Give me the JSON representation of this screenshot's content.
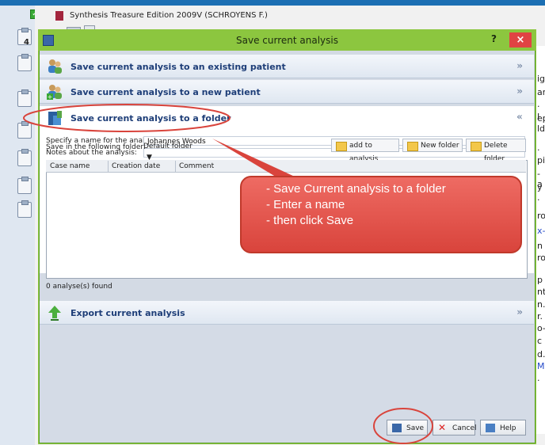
{
  "background_app": {
    "title": "Synthesis Treasure Edition 2009V (SCHROYENS F.)",
    "sidebar_number": "4",
    "right_fragments": [
      "ig",
      "ar",
      "· I",
      "ep",
      "ld",
      ".",
      "pis",
      "-a",
      "y",
      "·",
      "ro",
      "x-",
      " n",
      "ro",
      "p",
      "nt",
      "n.",
      "r.",
      "o-",
      " c",
      "d.",
      "M",
      "."
    ]
  },
  "dialog": {
    "title": "Save current analysis",
    "help_label": "?",
    "close_label": "×",
    "sections": {
      "existing_patient": "Save current analysis to an existing patient",
      "new_patient": "Save current analysis to a new patient",
      "folder": "Save current analysis to a folder",
      "export": "Export current analysis"
    },
    "folder_form": {
      "name_label": "Specify a name for the analysis:",
      "name_value": "Johannes Woods",
      "notes_label": "Notes about the analysis:",
      "notes_value": "",
      "folder_label": "Save in the following folder:",
      "folder_value": "Default folder",
      "buttons": {
        "add_to_analysis": "add to analysis",
        "new_folder": "New folder",
        "delete_folder": "Delete folder"
      },
      "table_headers": [
        "Case name",
        "Creation date",
        "Comment"
      ],
      "found_text": "0 analyse(s) found"
    },
    "footer_buttons": {
      "save": "Save",
      "cancel": "Cancel",
      "help": "Help"
    }
  },
  "callout": {
    "lines": [
      "- Save Current analysis to a folder",
      "- Enter a name",
      "- then click Save"
    ]
  },
  "colors": {
    "titlebar": "#8cc63f",
    "section_text": "#1e3e78",
    "callout": "#d9443c",
    "annotation_circle": "#d9443c"
  }
}
